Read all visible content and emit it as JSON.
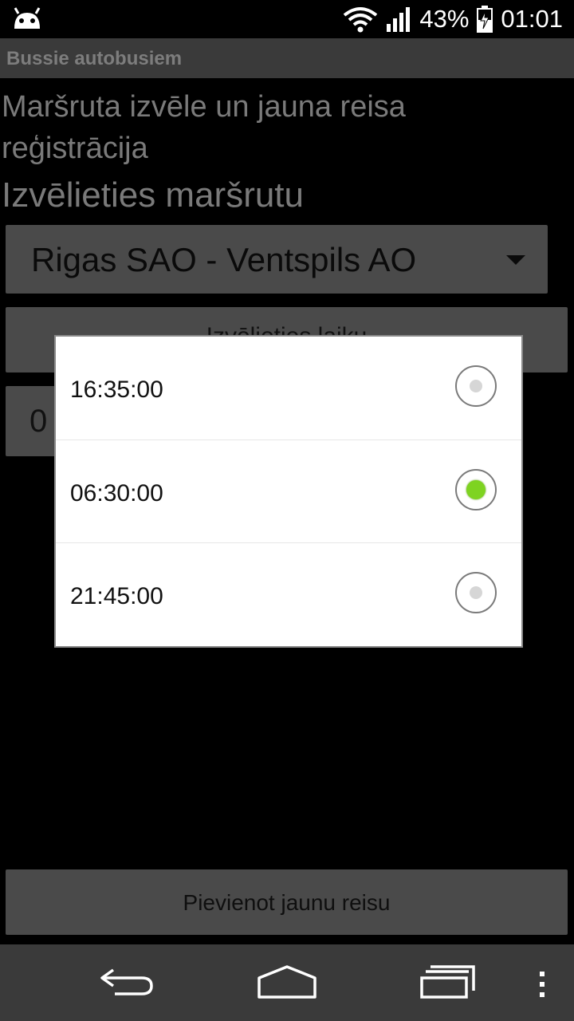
{
  "status_bar": {
    "battery": "43%",
    "time": "01:01"
  },
  "app": {
    "title": "Bussie autobusiem",
    "heading": "Maršruta izvēle un jauna reisa reģistrācija",
    "route_label": "Izvēlieties maršrutu",
    "route_selected": "Rigas SAO - Ventspils AO",
    "choose_time_button": "Izvēlieties laiku",
    "time_field_value": "0",
    "add_trip_button": "Pievienot jaunu reisu"
  },
  "dialog": {
    "options": [
      {
        "label": "16:35:00",
        "selected": false
      },
      {
        "label": "06:30:00",
        "selected": true
      },
      {
        "label": "21:45:00",
        "selected": false
      }
    ]
  },
  "icons": {
    "status": [
      "android-icon",
      "wifi-icon",
      "signal-icon",
      "battery-charging-icon"
    ],
    "nav": [
      "back-icon",
      "home-icon",
      "recent-apps-icon",
      "overflow-menu-icon"
    ]
  },
  "colors": {
    "radio_selected": "#7ed321",
    "dialog_background": "#ffffff",
    "titlebar": "#3a3a3a"
  }
}
